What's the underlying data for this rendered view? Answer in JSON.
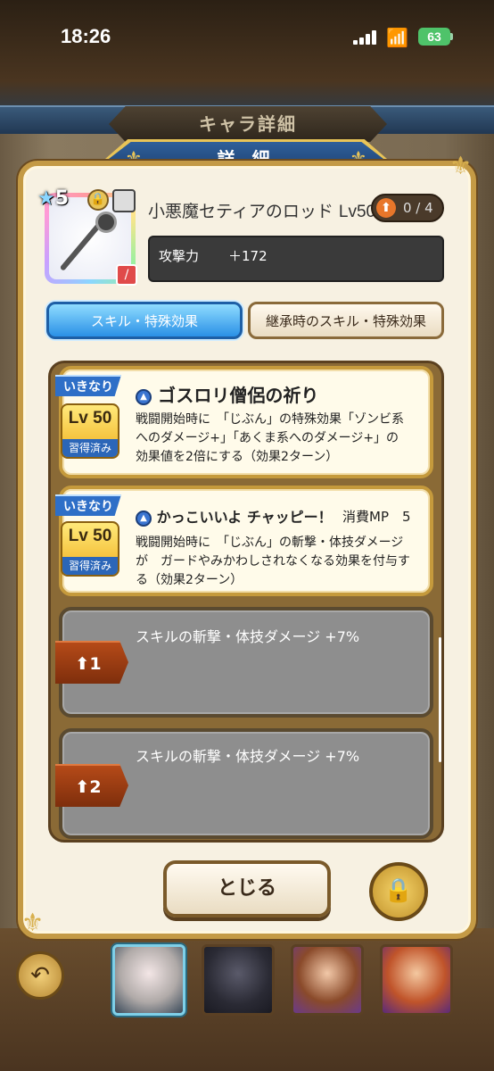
{
  "status_bar": {
    "time": "18:26",
    "battery": "63"
  },
  "header": {
    "screen_title": "キャラ詳細",
    "section_title": "詳 細"
  },
  "item": {
    "rarity": "5",
    "name": "小悪魔セティアのロッド",
    "level": "Lv50",
    "upgrade": "0 / 4",
    "stat_name": "攻撃力",
    "stat_value": "＋172"
  },
  "tabs": [
    {
      "label": "スキル・特殊効果",
      "active": true
    },
    {
      "label": "継承時のスキル・特殊効果",
      "active": false
    }
  ],
  "skills": [
    {
      "tag": "いきなり",
      "level": "Lv 50",
      "learned": "習得済み",
      "name": "ゴスロリ僧侶の祈り",
      "desc1": "戦闘開始時に　「じぶん」の特殊効果「ゾンビ系",
      "desc2": "へのダメージ+」「あくま系へのダメージ+」の",
      "desc3": "効果値を2倍にする（効果2ターン）"
    },
    {
      "tag": "いきなり",
      "level": "Lv 50",
      "learned": "習得済み",
      "name": "かっこいいよ チャッピー！",
      "mp_label": "消費MP　5",
      "desc1": "戦闘開始時に　「じぶん」の斬撃・体技ダメージ",
      "desc2": "が　ガードやみかわしされなくなる効果を付与す",
      "desc3": "る（効果2ターン）"
    }
  ],
  "passives": [
    {
      "rank": "1",
      "text": "スキルの斬撃・体技ダメージ +7%"
    },
    {
      "rank": "2",
      "text": "スキルの斬撃・体技ダメージ +7%"
    }
  ],
  "buttons": {
    "close": "とじる"
  },
  "icons": {
    "back": "undo-arrow-icon",
    "lock": "padlock-icon",
    "wifi": "wifi-icon",
    "upgrade": "up-arrow-icon"
  },
  "colors": {
    "tab_active": "#2a90e6",
    "panel_bg": "#f7f1e2",
    "gold_border": "#c49a45",
    "rank_tag": "#b54a18"
  }
}
